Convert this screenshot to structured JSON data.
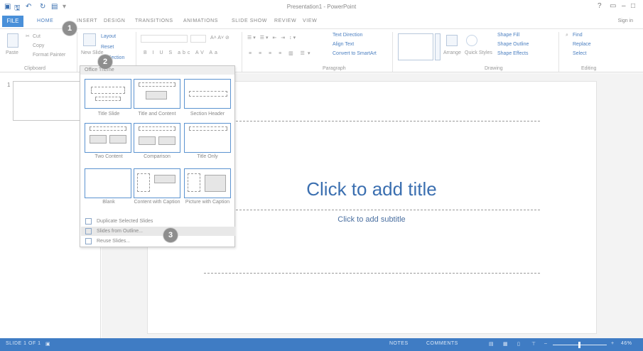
{
  "titlebar": {
    "document_title": "Presentation1 - PowerPoint",
    "help": "?",
    "minimize": "–",
    "restore": "□",
    "close": "×"
  },
  "tabs": {
    "file": "FILE",
    "home": "HOME",
    "insert": "INSERT",
    "design": "DESIGN",
    "transitions": "TRANSITIONS",
    "animations": "ANIMATIONS",
    "slide_show": "SLIDE SHOW",
    "review": "REVIEW",
    "view": "VIEW",
    "sign_in": "Sign in"
  },
  "ribbon": {
    "paste": "Paste",
    "cut": "Cut",
    "copy": "Copy",
    "format_painter": "Format Painter",
    "clipboard_group": "Clipboard",
    "new_slide": "New Slide",
    "layout": "Layout",
    "reset": "Reset",
    "section": "Section",
    "text_direction": "Text Direction",
    "align_text": "Align Text",
    "convert_smartart": "Convert to SmartArt",
    "paragraph_group": "Paragraph",
    "arrange": "Arrange",
    "quick_styles": "Quick Styles",
    "shape_fill": "Shape Fill",
    "shape_outline": "Shape Outline",
    "shape_effects": "Shape Effects",
    "drawing_group": "Drawing",
    "find": "Find",
    "replace": "Replace",
    "select": "Select",
    "editing_group": "Editing"
  },
  "dropdown": {
    "header": "Office Theme",
    "layouts": [
      "Title Slide",
      "Title and Content",
      "Section Header",
      "Two Content",
      "Comparison",
      "Title Only",
      "Blank",
      "Content with Caption",
      "Picture with Caption"
    ],
    "actions": [
      "Duplicate Selected Slides",
      "Slides from Outline...",
      "Reuse Slides..."
    ]
  },
  "callouts": [
    "1",
    "2",
    "3"
  ],
  "thumbnail": {
    "slide_number": "1"
  },
  "slide": {
    "title_placeholder": "Click to add title",
    "subtitle_placeholder": "Click to add subtitle"
  },
  "statusbar": {
    "slide_info": "SLIDE 1 OF 1",
    "notes": "NOTES",
    "comments": "COMMENTS",
    "zoom": "46%"
  },
  "colors": {
    "accent": "#4a90d9",
    "status_bar": "#3f7cc4",
    "title_text": "#3b6fb0"
  }
}
